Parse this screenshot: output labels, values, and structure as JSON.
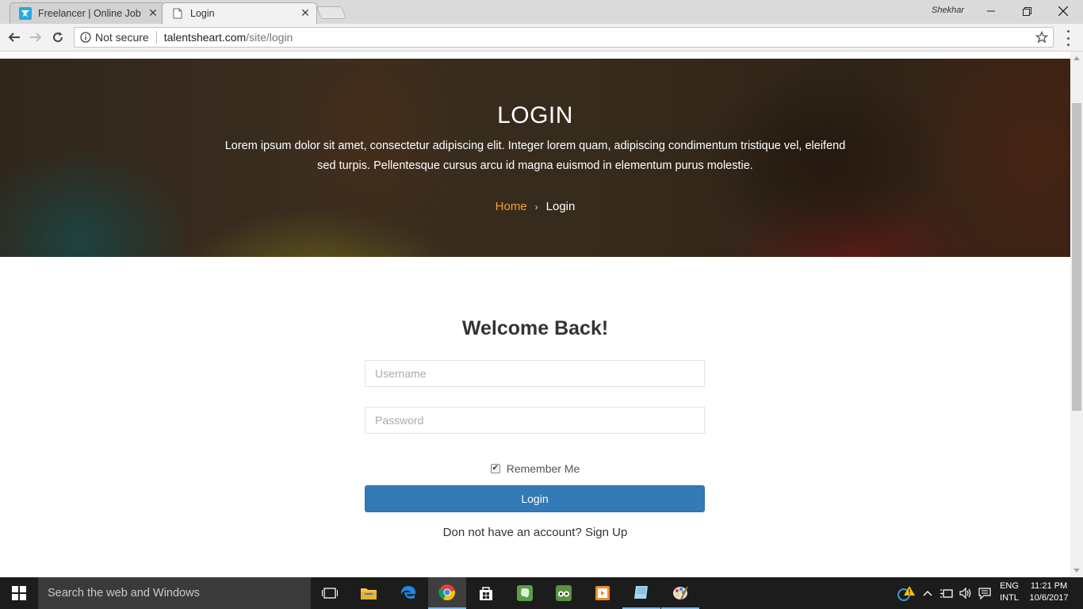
{
  "browser": {
    "tabs": [
      {
        "title": "Freelancer | Online Jobs |",
        "icon": "freelancer-logo-icon",
        "active": false
      },
      {
        "title": "Login",
        "icon": "page-icon",
        "active": true
      }
    ],
    "profile_name": "Shekhar",
    "security_label": "Not secure",
    "url_host": "talentsheart.com",
    "url_path": "/site/login"
  },
  "hero": {
    "title": "LOGIN",
    "text": "Lorem ipsum dolor sit amet, consectetur adipiscing elit. Integer lorem quam, adipiscing condimentum tristique vel, eleifend sed turpis. Pellentesque cursus arcu id magna euismod in elementum purus molestie.",
    "breadcrumb": {
      "home": "Home",
      "separator": "›",
      "current": "Login"
    }
  },
  "login_form": {
    "heading": "Welcome Back!",
    "username_placeholder": "Username",
    "password_placeholder": "Password",
    "remember_label": "Remember Me",
    "remember_checked": true,
    "submit_label": "Login",
    "signup_text": "Don not have an account? Sign Up"
  },
  "taskbar": {
    "search_placeholder": "Search the web and Windows",
    "apps": [
      "task-view-icon",
      "file-explorer-icon",
      "edge-icon",
      "chrome-icon",
      "store-icon",
      "evernote-icon",
      "tripadvisor-icon",
      "media-player-icon",
      "notes-icon",
      "paint-icon"
    ],
    "language_line1": "ENG",
    "language_line2": "INTL",
    "time": "11:21 PM",
    "date": "10/6/2017"
  },
  "colors": {
    "primary_button": "#337ab7",
    "breadcrumb_home": "#f0a030",
    "taskbar_bg": "#1c1c1c"
  }
}
